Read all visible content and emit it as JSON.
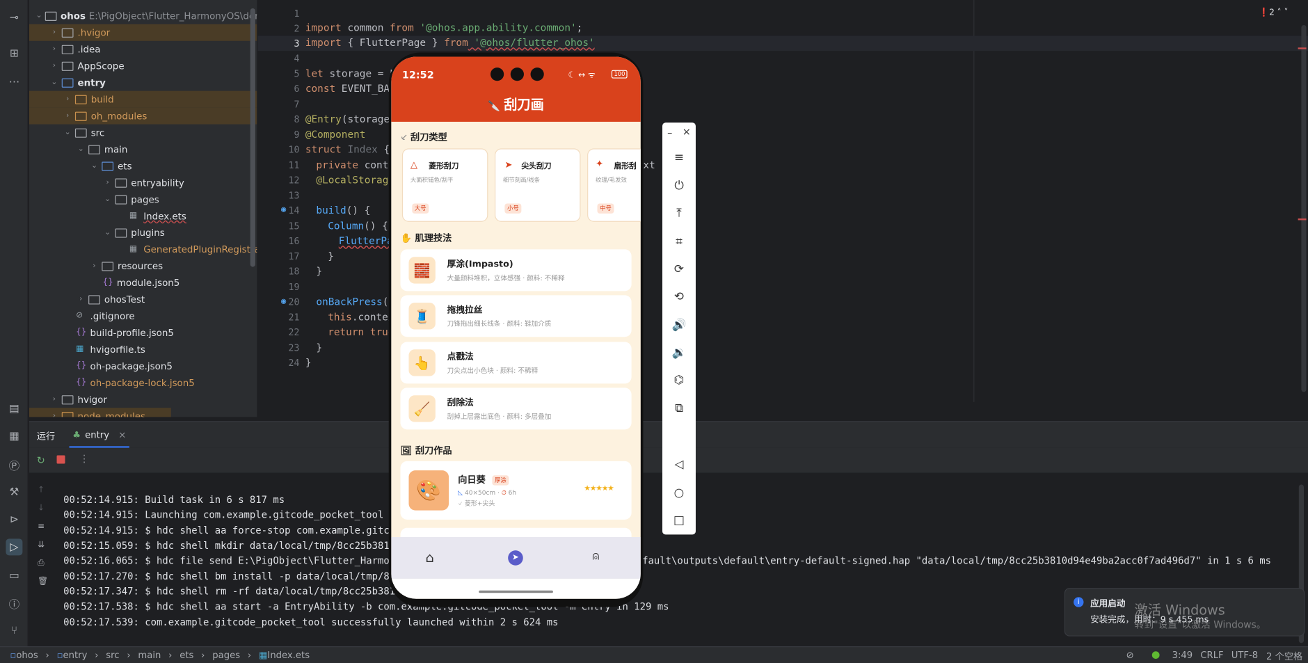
{
  "left_strip": {
    "icons": [
      "commit-icon",
      "structure-icon",
      "more-icon",
      "bookmark-icon",
      "database-icon",
      "profile-icon",
      "build-icon",
      "services-icon",
      "run-icon",
      "print-icon",
      "terminal-icon",
      "problems-icon",
      "git-icon"
    ]
  },
  "tree": {
    "root_name": "ohos",
    "root_path": "E:\\PigObject\\Flutter_HarmonyOS\\demo\\g",
    "items": [
      {
        "label": ".hvigor"
      },
      {
        "label": ".idea"
      },
      {
        "label": "AppScope"
      },
      {
        "label": "entry"
      },
      {
        "label": "build"
      },
      {
        "label": "oh_modules"
      },
      {
        "label": "src"
      },
      {
        "label": "main"
      },
      {
        "label": "ets"
      },
      {
        "label": "entryability"
      },
      {
        "label": "pages"
      },
      {
        "label": "Index.ets"
      },
      {
        "label": "plugins"
      },
      {
        "label": "GeneratedPluginRegistrant.e"
      },
      {
        "label": "resources"
      },
      {
        "label": "module.json5"
      },
      {
        "label": "ohosTest"
      },
      {
        "label": ".gitignore"
      },
      {
        "label": "build-profile.json5"
      },
      {
        "label": "hvigorfile.ts"
      },
      {
        "label": "oh-package.json5"
      },
      {
        "label": "oh-package-lock.json5"
      },
      {
        "label": "hvigor"
      },
      {
        "label": "node_modules"
      }
    ]
  },
  "editor": {
    "problems_count": "2",
    "line_numbers": [
      "1",
      "2",
      "3",
      "4",
      "5",
      "6",
      "7",
      "8",
      "9",
      "10",
      "11",
      "12",
      "13",
      "14",
      "15",
      "16",
      "17",
      "18",
      "19",
      "20",
      "21",
      "22",
      "23",
      "24"
    ],
    "lines": {
      "l1a": "import",
      "l1b": " common ",
      "l1c": "from",
      "l1d": " '@ohos.app.ability.common'",
      ";": ";",
      "l2a": "import",
      "l2b": " { FlutterPage } ",
      "l2c": "from",
      "l2d": " '@ohos/flutter_ohos'",
      "l5a": "let",
      "l5b": " storage = L",
      "l6a": "const",
      "l6b": " EVENT_BAC",
      "l8a": "@Entry",
      "l8b": "(storage)",
      "l9a": "@Component",
      "l10a": "struct",
      "l10b": " Index ",
      "l10c": "{",
      "l11a": "private",
      "l11b": " conte",
      "l12a": "@LocalStorage",
      "l14a": "build",
      "l14b": "() {",
      "l15a": "Column",
      "l15b": "() {",
      "l16a": "FlutterPa",
      "l17": "}",
      "l18": "}",
      "l20a": "onBackPress",
      "l20b": "()",
      "l21a": "this",
      "l21b": ".contex",
      "l22a": "return",
      "l22b": " true",
      "l23": "}",
      "l24": "}",
      "xt": "xt"
    }
  },
  "run_panel": {
    "tab_run": "运行",
    "tab_entry": "entry",
    "console": [
      "00:52:14.915: Build task in 6 s 817 ms",
      "00:52:14.915: Launching com.example.gitcode_pocket_tool",
      "00:52:14.915: $ hdc shell aa force-stop com.example.gitcod",
      "00:52:15.059: $ hdc shell mkdir data/local/tmp/8cc25b3810d",
      "00:52:16.065: $ hdc file send E:\\PigObject\\Flutter_Harmony",
      "00:52:17.270: $ hdc shell bm install -p data/local/tmp/8cc",
      "00:52:17.347: $ hdc shell rm -rf data/local/tmp/8cc25b3810d",
      "00:52:17.538: $ hdc shell aa start -a EntryAbility -b com.example.gitcode_pocket_tool -m entry in 129 ms",
      "00:52:17.539: com.example.gitcode_pocket_tool successfully launched within 2 s 624 ms"
    ],
    "console_tail": "efault\\outputs\\default\\entry-default-signed.hap \"data/local/tmp/8cc25b3810d94e49ba2acc0f7ad496d7\" in 1 s 6 ms"
  },
  "status_bar": {
    "breadcrumb": [
      "ohos",
      "entry",
      "src",
      "main",
      "ets",
      "pages",
      "Index.ets"
    ],
    "position": "3:49",
    "line_sep": "CRLF",
    "encoding": "UTF-8",
    "indent": "2 个空格"
  },
  "phone": {
    "time": "12:52",
    "battery": "100",
    "app_title": "刮刀画",
    "section_types": "刮刀类型",
    "types": [
      {
        "name": "菱形刮刀",
        "desc": "大面积铺色/刮平",
        "badge": "大号"
      },
      {
        "name": "尖头刮刀",
        "desc": "细节刻画/线条",
        "badge": "小号"
      },
      {
        "name": "扇形刮",
        "desc": "纹理/毛发效",
        "badge": "中号"
      }
    ],
    "section_tech": "肌理技法",
    "techniques": [
      {
        "name": "厚涂(Impasto)",
        "desc": "大量颜料堆积，立体感强 · 颜料: 不稀释"
      },
      {
        "name": "拖拽拉丝",
        "desc": "刀锋拖出细长线条 · 颜料: 鞋加介质"
      },
      {
        "name": "点戳法",
        "desc": "刀尖点出小色块 · 颜料: 不稀释"
      },
      {
        "name": "刮除法",
        "desc": "刮掉上层露出底色 · 颜料: 多层叠加"
      }
    ],
    "section_works": "刮刀作品",
    "work": {
      "title": "向日葵",
      "badge": "厚涂",
      "size": "40×50cm",
      "time": "6h",
      "tools": "菱形+尖头",
      "rating": "★★★★★"
    },
    "nav": [
      "home-icon",
      "compass-icon",
      "profile-icon"
    ]
  },
  "emulator_toolbar": {
    "buttons": [
      "minimize",
      "close",
      "menu-icon",
      "power-icon",
      "upload-icon",
      "crop-icon",
      "rotate-icon",
      "rotate-ccw-icon",
      "volume-up-icon",
      "volume-down-icon",
      "shake-icon",
      "screenshot-icon",
      "back-icon",
      "home-icon",
      "recents-icon"
    ]
  },
  "notification": {
    "title": "应用启动",
    "body": "安装完成，用时：9 s 455 ms"
  },
  "watermark": {
    "line1": "激活 Windows",
    "line2": "转到\"设置\"以激活 Windows。"
  },
  "colors": {
    "accent": "#d9421c",
    "app_bg": "#fdf2df",
    "ide_bg": "#1e1f22",
    "panel": "#2b2d30"
  }
}
